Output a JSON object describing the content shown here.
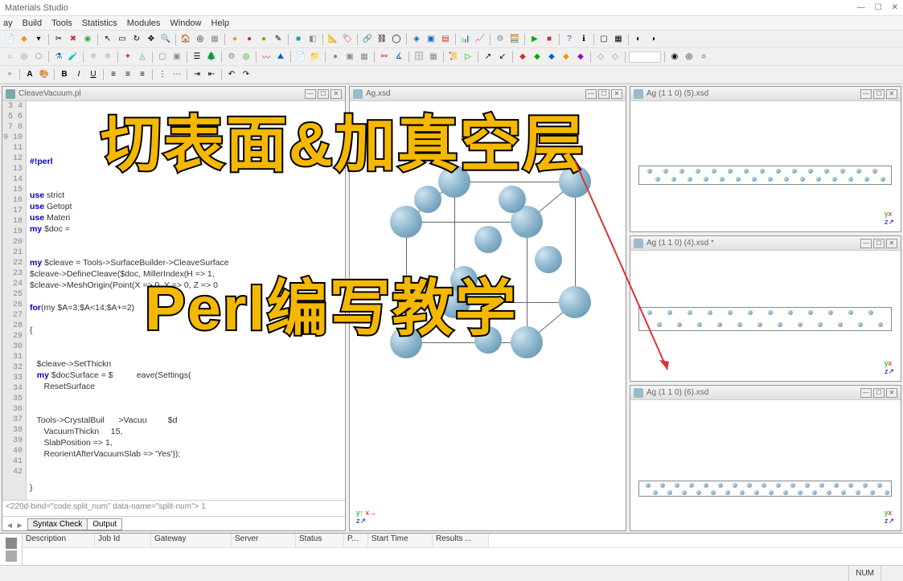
{
  "app": {
    "title": "Materials Studio"
  },
  "menu": {
    "items": [
      "ay",
      "Build",
      "Tools",
      "Statistics",
      "Modules",
      "Window",
      "Help"
    ]
  },
  "panels": {
    "code": {
      "title": "CleaveVacuum.pl"
    },
    "viewer": {
      "title": "Ag.xsd"
    },
    "side1": {
      "title": "Ag (1 1 0) (5).xsd"
    },
    "side2": {
      "title": "Ag (1 1 0) (4).xsd *"
    },
    "side3": {
      "title": "Ag (1 1 0) (6).xsd"
    }
  },
  "code": {
    "lines": [
      "3",
      "4",
      "5",
      "6",
      "7",
      "8",
      "9",
      "10",
      "11",
      "12",
      "13",
      "14",
      "15",
      "16",
      "17",
      "18",
      "19",
      "20",
      "21",
      "22",
      "23",
      "24",
      "25",
      "26",
      "27",
      "28",
      "29",
      "30",
      "31",
      "32",
      "33",
      "34",
      "35",
      "36",
      "37",
      "38",
      "39",
      "40",
      "41",
      "42"
    ],
    "l7": "#!perl",
    "l10a": "use",
    "l10b": " strict",
    "l11a": "use",
    "l11b": " Getopt",
    "l12a": "use",
    "l12b": " Materi",
    "l13a": "my",
    "l13b": " $doc = ",
    "l16a": "my",
    "l16b": " $cleave = Tools->SurfaceBuilder->CleaveSurface",
    "l17": "$cleave->DefineCleave($doc, MillerIndex(H => 1, ",
    "l18": "$cleave->MeshOrigin(Point(X => 0, Y => 0, Z => 0",
    "l20a": "for",
    "l20b": "(my $A=3;$A<14;$A+=2)",
    "l22": "{",
    "l25": "   $cleave->SetThickn",
    "l26a": "   my",
    "l26b": " $docSurface = $",
    "l26c": "eave(Settings(",
    "l27": "      ResetSurface",
    "l30": "   Tools->CrystalBuil",
    "l30b": ">Vacuu",
    "l30c": "$d",
    "l31": "      VacuumThickn",
    "l31b": " 15,",
    "l32": "      SlabPosition => 1,",
    "l33": "      ReorientAfterVacuumSlab => 'Yes'));",
    "l37": "}",
    "tab_nav": "◄ ►",
    "tabs": [
      "Syntax Check",
      "Output"
    ],
    "split_num": "1"
  },
  "jobgrid": {
    "cols": [
      "Description",
      "Job Id",
      "Gateway",
      "Server",
      "Status",
      "P...",
      "Start Time",
      "Results ..."
    ]
  },
  "status": {
    "num": "NUM"
  },
  "overlay": {
    "text1": "切表面&加真空层",
    "text2": "Perl编写教学"
  }
}
